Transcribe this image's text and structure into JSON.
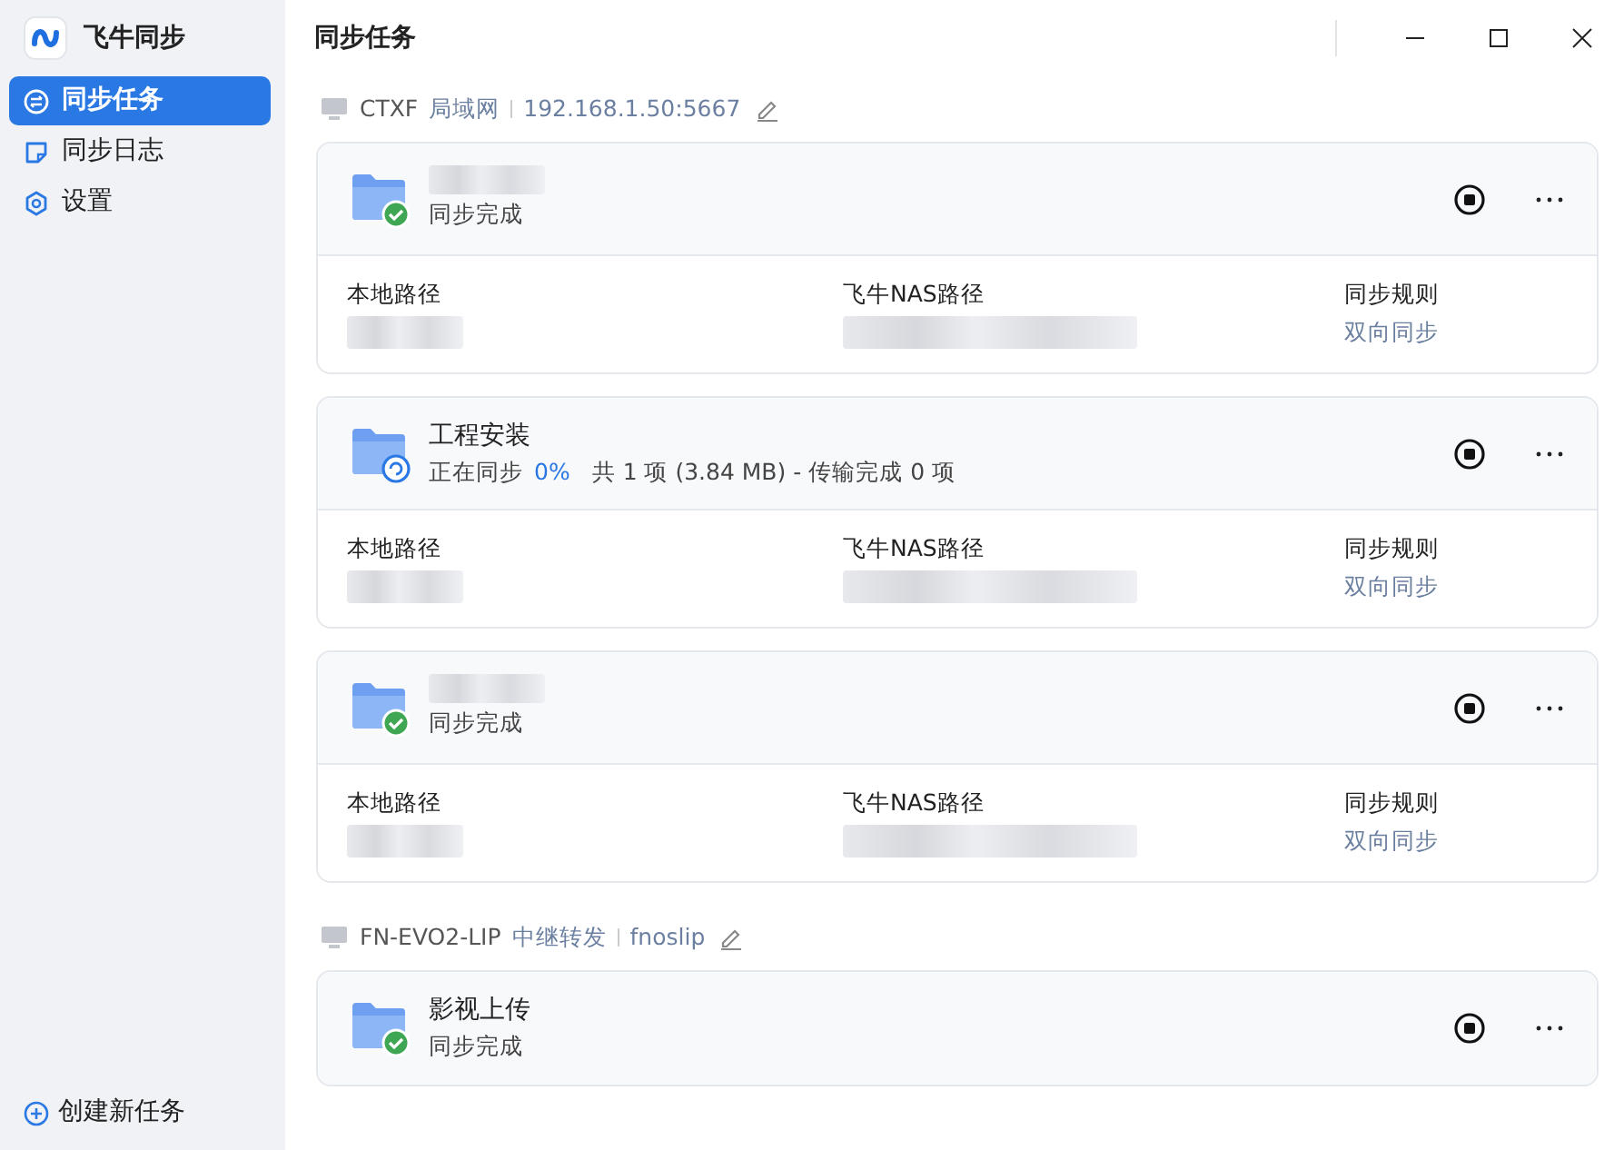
{
  "app": {
    "title": "飞牛同步"
  },
  "nav": [
    {
      "label": "同步任务",
      "selected": true
    },
    {
      "label": "同步日志",
      "selected": false
    },
    {
      "label": "设置",
      "selected": false
    }
  ],
  "create_button": "创建新任务",
  "page_title": "同步任务",
  "groups": [
    {
      "device": "CTXF",
      "connection": "局域网",
      "address": "192.168.1.50:5667",
      "tasks": [
        {
          "name_hidden": true,
          "kind": "done",
          "status": "同步完成",
          "columns": [
            {
              "label": "本地路径",
              "value_hidden": true
            },
            {
              "label": "飞牛NAS路径",
              "value_hidden": true
            },
            {
              "label": "同步规则",
              "value": "双向同步"
            }
          ]
        },
        {
          "name": "工程安装",
          "name_hidden": false,
          "kind": "syncing",
          "status": "正在同步",
          "progress": "0%",
          "summary": "共 1 项 (3.84 MB) - 传输完成 0 项",
          "columns": [
            {
              "label": "本地路径",
              "value_hidden": true
            },
            {
              "label": "飞牛NAS路径",
              "value_hidden": true
            },
            {
              "label": "同步规则",
              "value": "双向同步"
            }
          ]
        },
        {
          "name_hidden": true,
          "kind": "done",
          "status": "同步完成",
          "columns": [
            {
              "label": "本地路径",
              "value_hidden": true
            },
            {
              "label": "飞牛NAS路径",
              "value_hidden": true
            },
            {
              "label": "同步规则",
              "value": "双向同步"
            }
          ]
        }
      ]
    },
    {
      "device": "FN-EVO2-LIP",
      "connection": "中继转发",
      "address": "fnoslip",
      "tasks": [
        {
          "name": "影视上传",
          "name_hidden": false,
          "kind": "done",
          "status": "同步完成"
        }
      ]
    }
  ]
}
